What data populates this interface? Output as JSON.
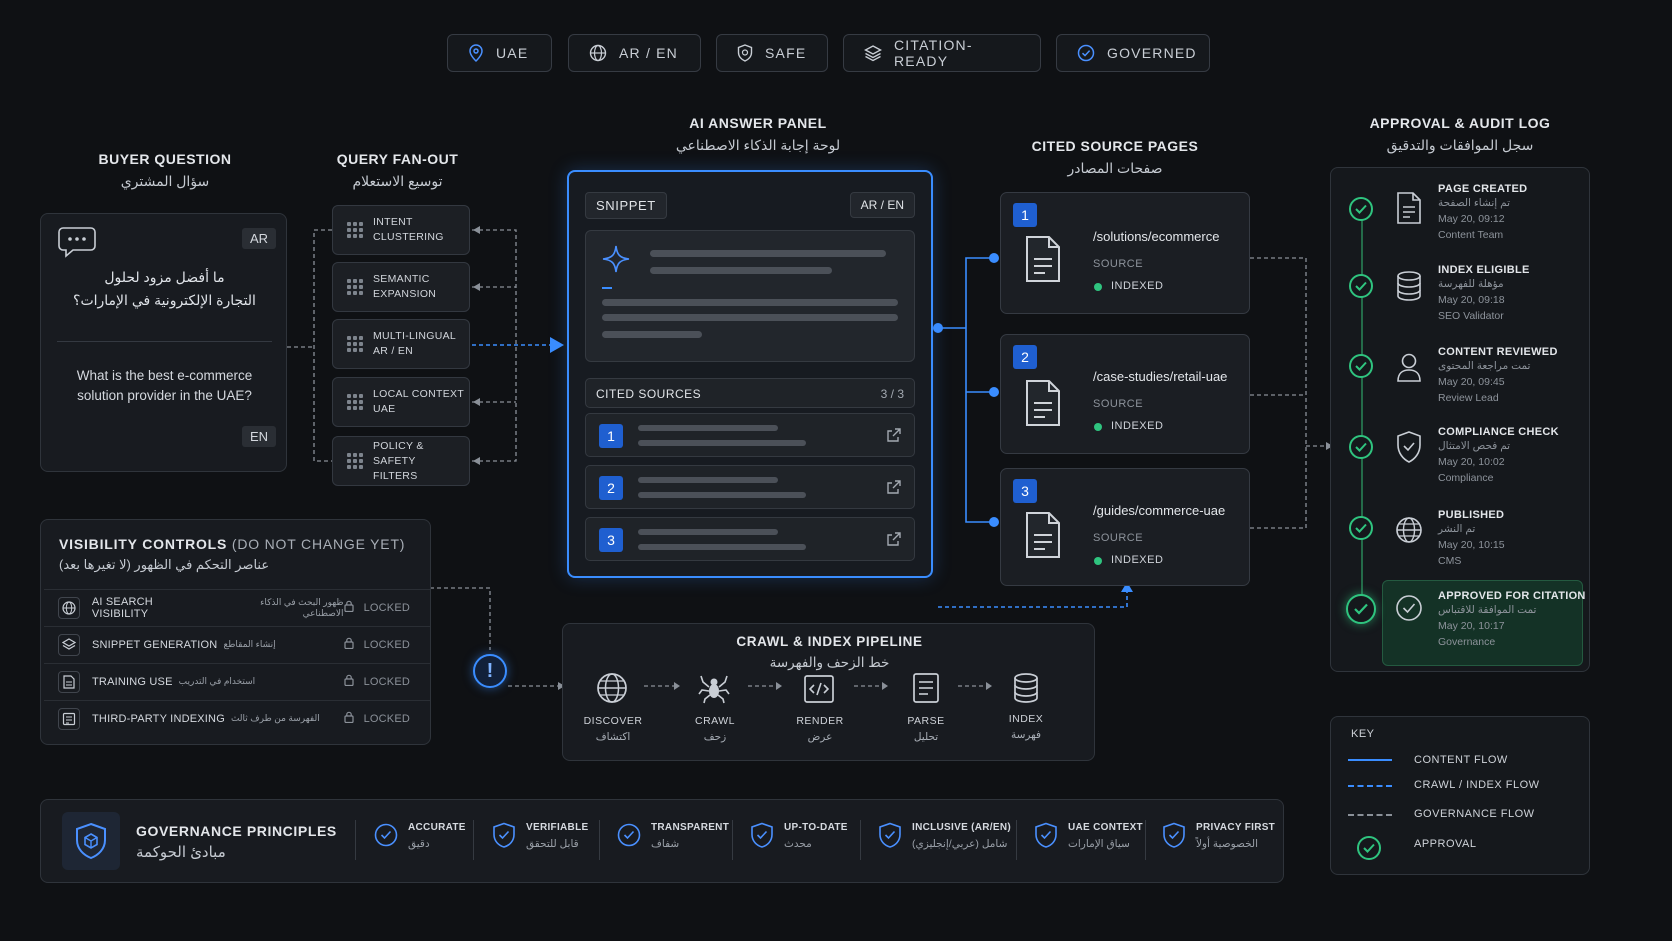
{
  "badges": [
    {
      "label": "UAE",
      "icon": "map-pin-icon"
    },
    {
      "label": "AR / EN",
      "icon": "globe-icon"
    },
    {
      "label": "SAFE",
      "icon": "shield-icon"
    },
    {
      "label": "CITATION-READY",
      "icon": "layers-icon"
    },
    {
      "label": "GOVERNED",
      "icon": "check-circle-icon"
    }
  ],
  "buyer": {
    "title": "BUYER QUESTION",
    "title_ar": "سؤال المشتري",
    "lang_ar": "AR",
    "lang_en": "EN",
    "question_ar_1": "ما أفضل مزود لحلول",
    "question_ar_2": "التجارة الإلكترونية في الإمارات؟",
    "question_en_1": "What is the best e-commerce",
    "question_en_2": "solution provider in the UAE?"
  },
  "fanout": {
    "title": "QUERY FAN-OUT",
    "title_ar": "توسيع الاستعلام",
    "items": [
      {
        "line1": "INTENT",
        "line2": "CLUSTERING"
      },
      {
        "line1": "SEMANTIC",
        "line2": "EXPANSION"
      },
      {
        "line1": "MULTI-LINGUAL",
        "line2": "AR / EN"
      },
      {
        "line1": "LOCAL CONTEXT",
        "line2": "UAE"
      },
      {
        "line1": "POLICY & SAFETY",
        "line2": "FILTERS"
      }
    ]
  },
  "answer": {
    "title": "AI ANSWER PANEL",
    "title_ar": "لوحة إجابة الذكاء الاصطناعي",
    "snippet_label": "SNIPPET",
    "lang_label": "AR / EN",
    "cited_label": "CITED SOURCES",
    "cited_count": "3 / 3",
    "sources": [
      "1",
      "2",
      "3"
    ]
  },
  "cited_pages": {
    "title": "CITED SOURCE PAGES",
    "title_ar": "صفحات المصادر",
    "pages": [
      {
        "num": "1",
        "path": "/solutions/ecommerce",
        "source": "SOURCE",
        "status": "INDEXED"
      },
      {
        "num": "2",
        "path": "/case-studies/retail-uae",
        "source": "SOURCE",
        "status": "INDEXED"
      },
      {
        "num": "3",
        "path": "/guides/commerce-uae",
        "source": "SOURCE",
        "status": "INDEXED"
      }
    ]
  },
  "audit": {
    "title": "APPROVAL & AUDIT LOG",
    "title_ar": "سجل الموافقات والتدقيق",
    "items": [
      {
        "title": "PAGE CREATED",
        "ar": "تم إنشاء الصفحة",
        "time": "May 20, 09:12",
        "by": "Content Team",
        "icon": "document-icon"
      },
      {
        "title": "INDEX ELIGIBLE",
        "ar": "مؤهلة للفهرسة",
        "time": "May 20, 09:18",
        "by": "SEO Validator",
        "icon": "database-icon"
      },
      {
        "title": "CONTENT REVIEWED",
        "ar": "تمت مراجعة المحتوى",
        "time": "May 20, 09:45",
        "by": "Review Lead",
        "icon": "user-icon"
      },
      {
        "title": "COMPLIANCE CHECK",
        "ar": "تم فحص الامتثال",
        "time": "May 20, 10:02",
        "by": "Compliance",
        "icon": "shield-icon"
      },
      {
        "title": "PUBLISHED",
        "ar": "تم النشر",
        "time": "May 20, 10:15",
        "by": "CMS",
        "icon": "globe-icon"
      },
      {
        "title": "APPROVED FOR CITATION",
        "ar": "تمت الموافقة للاقتباس",
        "time": "May 20, 10:17",
        "by": "Governance",
        "icon": "check-circle-icon"
      }
    ]
  },
  "visibility": {
    "title": "VISIBILITY CONTROLS",
    "title_note": "(DO NOT CHANGE YET)",
    "title_ar": "عناصر التحكم في الظهور (لا تغيرها بعد)",
    "rows": [
      {
        "label": "AI SEARCH VISIBILITY",
        "ar": "ظهور البحث في الذكاء الاصطناعي",
        "status": "LOCKED",
        "icon": "globe-icon"
      },
      {
        "label": "SNIPPET GENERATION",
        "ar": "إنشاء المقاطع",
        "status": "LOCKED",
        "icon": "layers-icon"
      },
      {
        "label": "TRAINING USE",
        "ar": "استخدام في التدريب",
        "status": "LOCKED",
        "icon": "document-icon"
      },
      {
        "label": "THIRD-PARTY INDEXING",
        "ar": "الفهرسة من طرف ثالث",
        "status": "LOCKED",
        "icon": "index-doc-icon"
      }
    ]
  },
  "pipeline": {
    "title": "CRAWL & INDEX PIPELINE",
    "title_ar": "خط الزحف والفهرسة",
    "steps": [
      {
        "label": "DISCOVER",
        "ar": "اكتشاف",
        "icon": "globe-icon"
      },
      {
        "label": "CRAWL",
        "ar": "زحف",
        "icon": "spider-icon"
      },
      {
        "label": "RENDER",
        "ar": "عرض",
        "icon": "code-icon"
      },
      {
        "label": "PARSE",
        "ar": "تحليل",
        "icon": "document-icon"
      },
      {
        "label": "INDEX",
        "ar": "فهرسة",
        "icon": "database-icon"
      }
    ]
  },
  "governance": {
    "title": "GOVERNANCE PRINCIPLES",
    "title_ar": "مبادئ الحوكمة",
    "items": [
      {
        "label": "ACCURATE",
        "ar": "دقيق"
      },
      {
        "label": "VERIFIABLE",
        "ar": "قابل للتحقق"
      },
      {
        "label": "TRANSPARENT",
        "ar": "شفاف"
      },
      {
        "label": "UP-TO-DATE",
        "ar": "محدث"
      },
      {
        "label": "INCLUSIVE (AR/EN)",
        "ar": "شامل (عربي/إنجليزي)"
      },
      {
        "label": "UAE CONTEXT",
        "ar": "سياق الإمارات"
      },
      {
        "label": "PRIVACY FIRST",
        "ar": "الخصوصية أولاً"
      }
    ]
  },
  "key": {
    "title": "KEY",
    "content_flow": "CONTENT FLOW",
    "crawl_flow": "CRAWL / INDEX FLOW",
    "gov_flow": "GOVERNANCE FLOW",
    "approval": "APPROVAL"
  },
  "colors": {
    "accent_blue": "#3a8dff",
    "approval_green": "#2fc47f",
    "background": "#0f1114"
  }
}
